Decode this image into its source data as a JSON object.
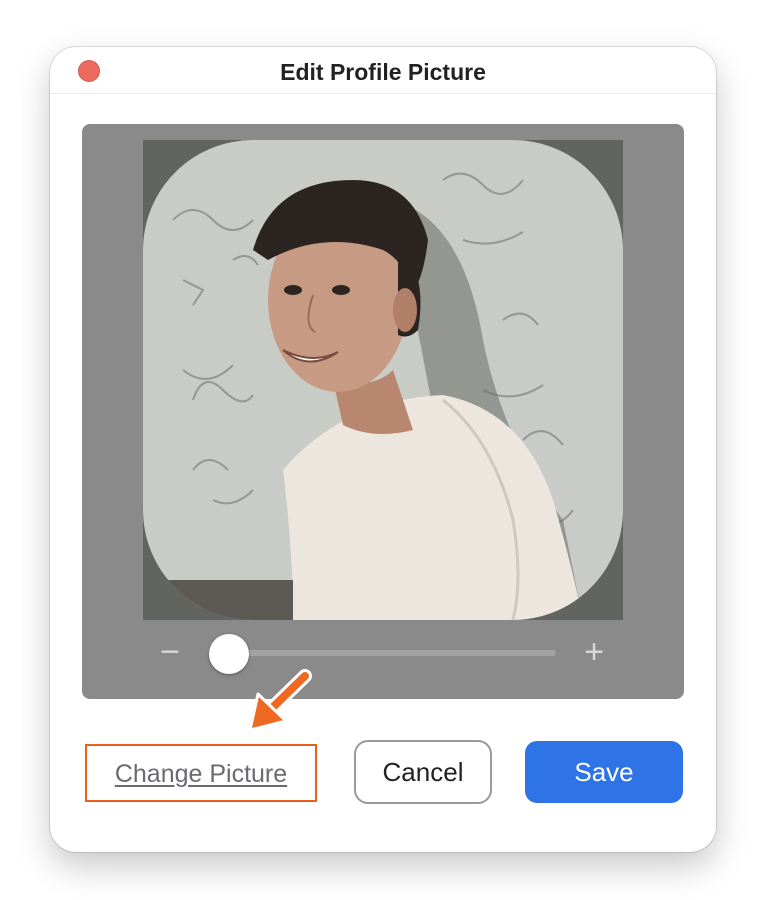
{
  "dialog": {
    "title": "Edit Profile Picture"
  },
  "editor": {
    "zoom_slider": {
      "minus_symbol": "−",
      "plus_symbol": "+",
      "value": 0.0
    },
    "photo": {
      "description": "profile-photo"
    }
  },
  "actions": {
    "change_picture_label": "Change Picture",
    "cancel_label": "Cancel",
    "save_label": "Save"
  },
  "colors": {
    "accent": "#2f74e6",
    "highlight": "#e8601c",
    "close": "#ec6a5e",
    "editor_bg": "#8a8a8a"
  },
  "icons": {
    "close": "close-dot-icon",
    "annotation": "arrow-icon"
  }
}
